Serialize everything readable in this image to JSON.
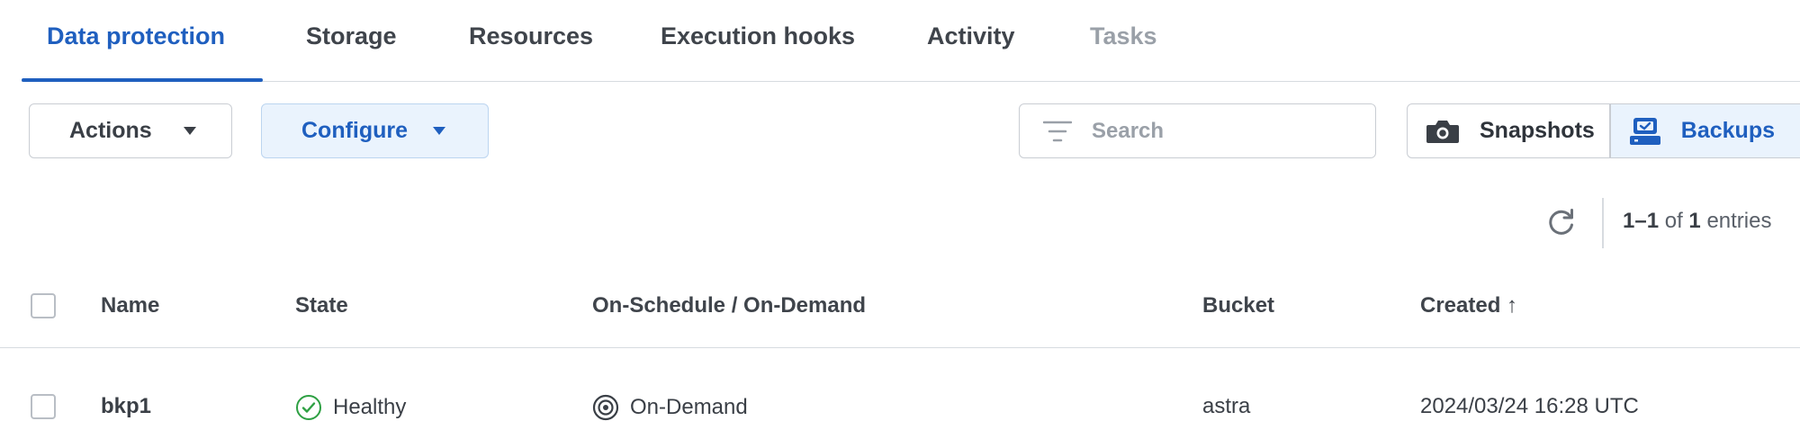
{
  "tabs": [
    {
      "label": "Data protection",
      "state": "active"
    },
    {
      "label": "Storage",
      "state": "normal"
    },
    {
      "label": "Resources",
      "state": "normal"
    },
    {
      "label": "Execution hooks",
      "state": "normal"
    },
    {
      "label": "Activity",
      "state": "normal"
    },
    {
      "label": "Tasks",
      "state": "disabled"
    }
  ],
  "toolbar": {
    "actions_label": "Actions",
    "configure_label": "Configure",
    "search_placeholder": "Search",
    "view_toggle": [
      {
        "label": "Snapshots",
        "icon": "camera-icon",
        "selected": false
      },
      {
        "label": "Backups",
        "icon": "backup-drive-icon",
        "selected": true
      }
    ]
  },
  "pagination": {
    "range": "1–1",
    "of_text": "of",
    "total": "1",
    "unit": "entries"
  },
  "table": {
    "columns": [
      "Name",
      "State",
      "On-Schedule / On-Demand",
      "Bucket",
      "Created ↑"
    ],
    "rows": [
      {
        "name": "bkp1",
        "state": "Healthy",
        "schedule": "On-Demand",
        "bucket": "astra",
        "created": "2024/03/24 16:28 UTC"
      }
    ]
  },
  "colors": {
    "accent": "#1f5fbf",
    "accent_bg": "#eaf3fd",
    "healthy": "#2ea043",
    "border": "#c9cdd3"
  }
}
